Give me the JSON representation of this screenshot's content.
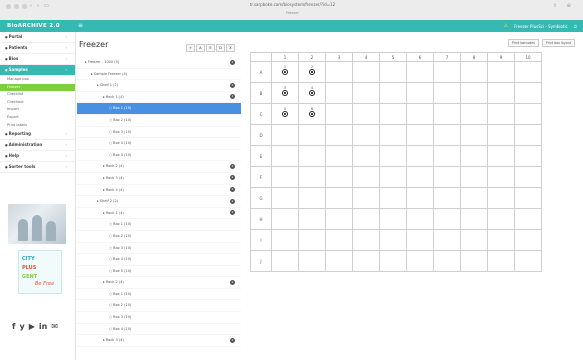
{
  "browser": {
    "url": "tr.sarpboke.com/biosystem/frenzer/?id=12",
    "tab_title": "Freezer"
  },
  "app": {
    "brand": "BioARCHIVE 2.0",
    "user": "Freezer PlusSci - Symbiotic"
  },
  "sidebar": {
    "items": [
      {
        "label": "Portal",
        "active": false
      },
      {
        "label": "Patients",
        "active": false
      },
      {
        "label": "Bios",
        "active": false
      },
      {
        "label": "Samples",
        "active": true
      }
    ],
    "subitems": [
      {
        "label": "Manage box",
        "active": false
      },
      {
        "label": "Freezer",
        "active": true
      },
      {
        "label": "Checklist",
        "active": false
      },
      {
        "label": "Checkout",
        "active": false
      },
      {
        "label": "Import",
        "active": false
      },
      {
        "label": "Export",
        "active": false
      },
      {
        "label": "Print labels",
        "active": false
      }
    ],
    "items2": [
      {
        "label": "Reporting"
      },
      {
        "label": "Administration"
      },
      {
        "label": "Help"
      },
      {
        "label": "Sorter tools"
      }
    ],
    "logo_lines": [
      "CITY",
      "PLUS",
      "GENT",
      "Be Free"
    ],
    "social": [
      "f",
      "y",
      "yt",
      "in",
      "m"
    ]
  },
  "tree": {
    "title": "Freezer",
    "toolbar": [
      "+",
      "A",
      "E",
      "D",
      "X"
    ],
    "rows": [
      {
        "label": "Freezer - 1000 (5)",
        "indent": 0,
        "badge": "1",
        "sel": false
      },
      {
        "label": "Sample Freezer (4)",
        "indent": 1,
        "badge": "",
        "sel": false
      },
      {
        "label": "Shelf 1 (2)",
        "indent": 2,
        "badge": "1",
        "sel": false
      },
      {
        "label": "Rack 1 (4)",
        "indent": 3,
        "badge": "1",
        "sel": false
      },
      {
        "label": "Box 1 (10)",
        "indent": 4,
        "badge": "",
        "sel": true
      },
      {
        "label": "Box 2 (10)",
        "indent": 4,
        "badge": "",
        "sel": false
      },
      {
        "label": "Box 3 (10)",
        "indent": 4,
        "badge": "",
        "sel": false
      },
      {
        "label": "Box 4 (10)",
        "indent": 4,
        "badge": "",
        "sel": false
      },
      {
        "label": "Box 5 (10)",
        "indent": 4,
        "badge": "",
        "sel": false
      },
      {
        "label": "Rack 2 (4)",
        "indent": 3,
        "badge": "1",
        "sel": false
      },
      {
        "label": "Rack 3 (4)",
        "indent": 3,
        "badge": "1",
        "sel": false
      },
      {
        "label": "Rack 4 (4)",
        "indent": 3,
        "badge": "1",
        "sel": false
      },
      {
        "label": "Shelf 2 (2)",
        "indent": 2,
        "badge": "1",
        "sel": false
      },
      {
        "label": "Rack 1 (4)",
        "indent": 3,
        "badge": "1",
        "sel": false
      },
      {
        "label": "Box 1 (10)",
        "indent": 4,
        "badge": "",
        "sel": false
      },
      {
        "label": "Box 2 (10)",
        "indent": 4,
        "badge": "",
        "sel": false
      },
      {
        "label": "Box 3 (10)",
        "indent": 4,
        "badge": "",
        "sel": false
      },
      {
        "label": "Box 4 (10)",
        "indent": 4,
        "badge": "",
        "sel": false
      },
      {
        "label": "Box 5 (10)",
        "indent": 4,
        "badge": "",
        "sel": false
      },
      {
        "label": "Rack 2 (4)",
        "indent": 3,
        "badge": "1",
        "sel": false
      },
      {
        "label": "Box 1 (10)",
        "indent": 4,
        "badge": "",
        "sel": false
      },
      {
        "label": "Box 2 (10)",
        "indent": 4,
        "badge": "",
        "sel": false
      },
      {
        "label": "Box 3 (10)",
        "indent": 4,
        "badge": "",
        "sel": false
      },
      {
        "label": "Box 4 (10)",
        "indent": 4,
        "badge": "",
        "sel": false
      },
      {
        "label": "Rack 3 (4)",
        "indent": 3,
        "badge": "1",
        "sel": false
      }
    ]
  },
  "panel": {
    "buttons": [
      "Print barcodes",
      "Print box layout"
    ],
    "columns": [
      "1",
      "2",
      "3",
      "4",
      "5",
      "6",
      "7",
      "8",
      "9",
      "10"
    ],
    "rows": [
      "A",
      "B",
      "C",
      "D",
      "E",
      "F",
      "G",
      "H",
      "I",
      "J"
    ],
    "tubes": [
      {
        "row": 0,
        "col": 0,
        "num": "1"
      },
      {
        "row": 0,
        "col": 1,
        "num": "2"
      },
      {
        "row": 1,
        "col": 0,
        "num": "3"
      },
      {
        "row": 1,
        "col": 1,
        "num": "4"
      },
      {
        "row": 2,
        "col": 0,
        "num": "5"
      },
      {
        "row": 2,
        "col": 1,
        "num": "6"
      }
    ]
  }
}
